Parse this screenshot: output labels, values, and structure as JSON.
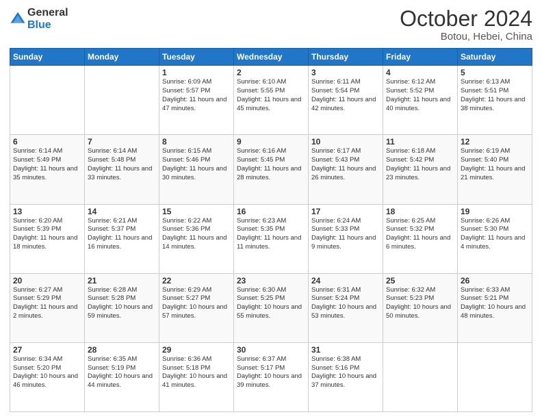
{
  "header": {
    "logo_line1": "General",
    "logo_line2": "Blue",
    "title": "October 2024",
    "subtitle": "Botou, Hebei, China"
  },
  "weekdays": [
    "Sunday",
    "Monday",
    "Tuesday",
    "Wednesday",
    "Thursday",
    "Friday",
    "Saturday"
  ],
  "weeks": [
    [
      {
        "day": "",
        "info": ""
      },
      {
        "day": "",
        "info": ""
      },
      {
        "day": "1",
        "info": "Sunrise: 6:09 AM\nSunset: 5:57 PM\nDaylight: 11 hours and 47 minutes."
      },
      {
        "day": "2",
        "info": "Sunrise: 6:10 AM\nSunset: 5:55 PM\nDaylight: 11 hours and 45 minutes."
      },
      {
        "day": "3",
        "info": "Sunrise: 6:11 AM\nSunset: 5:54 PM\nDaylight: 11 hours and 42 minutes."
      },
      {
        "day": "4",
        "info": "Sunrise: 6:12 AM\nSunset: 5:52 PM\nDaylight: 11 hours and 40 minutes."
      },
      {
        "day": "5",
        "info": "Sunrise: 6:13 AM\nSunset: 5:51 PM\nDaylight: 11 hours and 38 minutes."
      }
    ],
    [
      {
        "day": "6",
        "info": "Sunrise: 6:14 AM\nSunset: 5:49 PM\nDaylight: 11 hours and 35 minutes."
      },
      {
        "day": "7",
        "info": "Sunrise: 6:14 AM\nSunset: 5:48 PM\nDaylight: 11 hours and 33 minutes."
      },
      {
        "day": "8",
        "info": "Sunrise: 6:15 AM\nSunset: 5:46 PM\nDaylight: 11 hours and 30 minutes."
      },
      {
        "day": "9",
        "info": "Sunrise: 6:16 AM\nSunset: 5:45 PM\nDaylight: 11 hours and 28 minutes."
      },
      {
        "day": "10",
        "info": "Sunrise: 6:17 AM\nSunset: 5:43 PM\nDaylight: 11 hours and 26 minutes."
      },
      {
        "day": "11",
        "info": "Sunrise: 6:18 AM\nSunset: 5:42 PM\nDaylight: 11 hours and 23 minutes."
      },
      {
        "day": "12",
        "info": "Sunrise: 6:19 AM\nSunset: 5:40 PM\nDaylight: 11 hours and 21 minutes."
      }
    ],
    [
      {
        "day": "13",
        "info": "Sunrise: 6:20 AM\nSunset: 5:39 PM\nDaylight: 11 hours and 18 minutes."
      },
      {
        "day": "14",
        "info": "Sunrise: 6:21 AM\nSunset: 5:37 PM\nDaylight: 11 hours and 16 minutes."
      },
      {
        "day": "15",
        "info": "Sunrise: 6:22 AM\nSunset: 5:36 PM\nDaylight: 11 hours and 14 minutes."
      },
      {
        "day": "16",
        "info": "Sunrise: 6:23 AM\nSunset: 5:35 PM\nDaylight: 11 hours and 11 minutes."
      },
      {
        "day": "17",
        "info": "Sunrise: 6:24 AM\nSunset: 5:33 PM\nDaylight: 11 hours and 9 minutes."
      },
      {
        "day": "18",
        "info": "Sunrise: 6:25 AM\nSunset: 5:32 PM\nDaylight: 11 hours and 6 minutes."
      },
      {
        "day": "19",
        "info": "Sunrise: 6:26 AM\nSunset: 5:30 PM\nDaylight: 11 hours and 4 minutes."
      }
    ],
    [
      {
        "day": "20",
        "info": "Sunrise: 6:27 AM\nSunset: 5:29 PM\nDaylight: 11 hours and 2 minutes."
      },
      {
        "day": "21",
        "info": "Sunrise: 6:28 AM\nSunset: 5:28 PM\nDaylight: 10 hours and 59 minutes."
      },
      {
        "day": "22",
        "info": "Sunrise: 6:29 AM\nSunset: 5:27 PM\nDaylight: 10 hours and 57 minutes."
      },
      {
        "day": "23",
        "info": "Sunrise: 6:30 AM\nSunset: 5:25 PM\nDaylight: 10 hours and 55 minutes."
      },
      {
        "day": "24",
        "info": "Sunrise: 6:31 AM\nSunset: 5:24 PM\nDaylight: 10 hours and 53 minutes."
      },
      {
        "day": "25",
        "info": "Sunrise: 6:32 AM\nSunset: 5:23 PM\nDaylight: 10 hours and 50 minutes."
      },
      {
        "day": "26",
        "info": "Sunrise: 6:33 AM\nSunset: 5:21 PM\nDaylight: 10 hours and 48 minutes."
      }
    ],
    [
      {
        "day": "27",
        "info": "Sunrise: 6:34 AM\nSunset: 5:20 PM\nDaylight: 10 hours and 46 minutes."
      },
      {
        "day": "28",
        "info": "Sunrise: 6:35 AM\nSunset: 5:19 PM\nDaylight: 10 hours and 44 minutes."
      },
      {
        "day": "29",
        "info": "Sunrise: 6:36 AM\nSunset: 5:18 PM\nDaylight: 10 hours and 41 minutes."
      },
      {
        "day": "30",
        "info": "Sunrise: 6:37 AM\nSunset: 5:17 PM\nDaylight: 10 hours and 39 minutes."
      },
      {
        "day": "31",
        "info": "Sunrise: 6:38 AM\nSunset: 5:16 PM\nDaylight: 10 hours and 37 minutes."
      },
      {
        "day": "",
        "info": ""
      },
      {
        "day": "",
        "info": ""
      }
    ]
  ]
}
